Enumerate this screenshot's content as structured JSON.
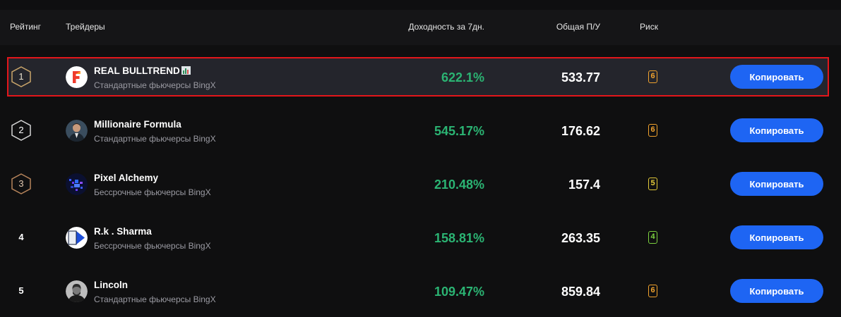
{
  "header": {
    "rank": "Рейтинг",
    "traders": "Трейдеры",
    "yield": "Доходность за 7дн.",
    "pnl": "Общая П/У",
    "risk": "Риск"
  },
  "colors": {
    "accent_button": "#1e65f3",
    "yield_green": "#2bb473",
    "highlight_border": "#e3161b",
    "risk_orange": "#f0a22e",
    "risk_yellow": "#e2c93a",
    "risk_green": "#7cd13f"
  },
  "traders": [
    {
      "rank": "1",
      "name": "REAL BULLTREND",
      "name_flag_icon": "chart-flag-icon",
      "subtitle": "Стандартные фьючерсы BingX",
      "yield": "622.1%",
      "pnl": "533.77",
      "risk": "6",
      "risk_color": "#f0a22e",
      "button": "Копировать",
      "avatar_icon": "f-logo-avatar"
    },
    {
      "rank": "2",
      "name": "Millionaire Formula",
      "subtitle": "Стандартные фьючерсы BingX",
      "yield": "545.17%",
      "pnl": "176.62",
      "risk": "6",
      "risk_color": "#f0a22e",
      "button": "Копировать",
      "avatar_icon": "person-avatar"
    },
    {
      "rank": "3",
      "name": "Pixel Alchemy",
      "subtitle": "Бессрочные фьючерсы BingX",
      "yield": "210.48%",
      "pnl": "157.4",
      "risk": "5",
      "risk_color": "#e2c93a",
      "button": "Копировать",
      "avatar_icon": "pixel-avatar"
    },
    {
      "rank": "4",
      "name": "R.k . Sharma",
      "subtitle": "Бессрочные фьючерсы BingX",
      "yield": "158.81%",
      "pnl": "263.35",
      "risk": "4",
      "risk_color": "#7cd13f",
      "button": "Копировать",
      "avatar_icon": "play-logo-avatar"
    },
    {
      "rank": "5",
      "name": "Lincoln",
      "subtitle": "Стандартные фьючерсы BingX",
      "yield": "109.47%",
      "pnl": "859.84",
      "risk": "6",
      "risk_color": "#f0a22e",
      "button": "Копировать",
      "avatar_icon": "portrait-avatar"
    }
  ]
}
